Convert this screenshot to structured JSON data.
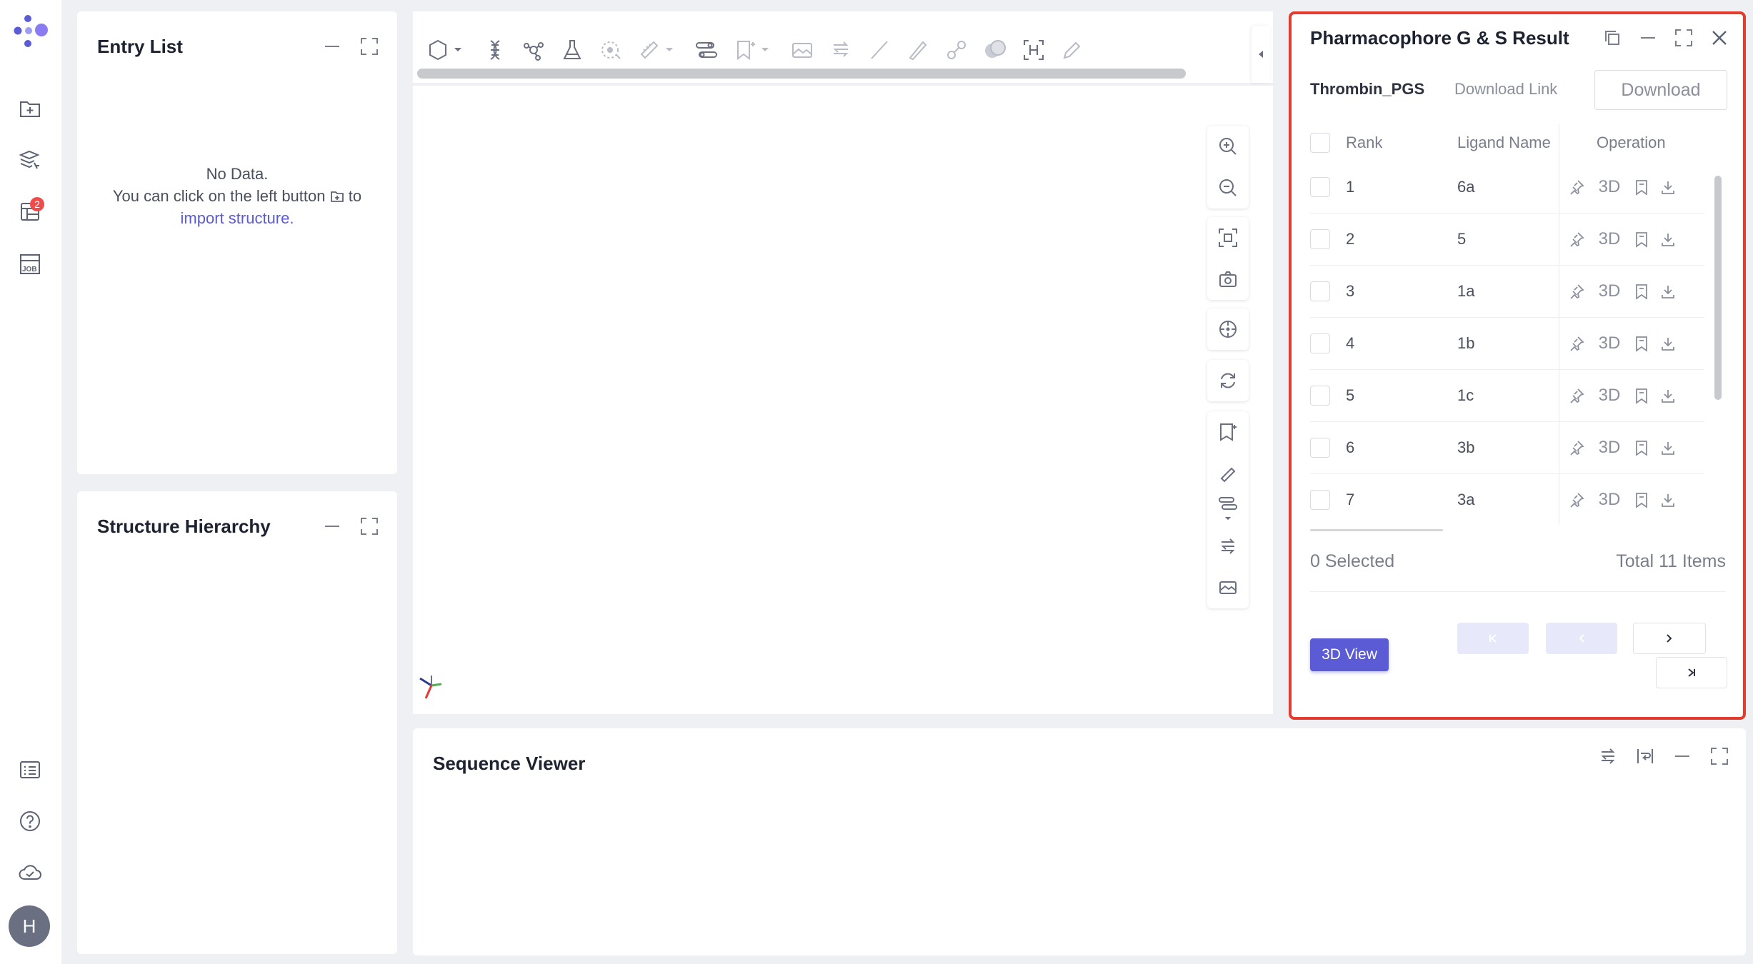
{
  "app": {
    "logo": "app-logo",
    "rail_badge": "2",
    "avatar_initial": "H"
  },
  "entry_list": {
    "title": "Entry List",
    "empty_line1": "No Data.",
    "empty_line2_pre": "You can click on the left button",
    "empty_line2_post": "to",
    "empty_link": "import structure."
  },
  "structure_hierarchy": {
    "title": "Structure Hierarchy"
  },
  "result_panel": {
    "title": "Pharmacophore G & S Result",
    "job_name": "Thrombin_PGS",
    "download_link_label": "Download Link",
    "download_button": "Download",
    "columns": {
      "rank": "Rank",
      "ligand": "Ligand Name",
      "operation": "Operation"
    },
    "op_3d_label": "3D",
    "rows": [
      {
        "rank": "1",
        "ligand": "6a"
      },
      {
        "rank": "2",
        "ligand": "5"
      },
      {
        "rank": "3",
        "ligand": "1a"
      },
      {
        "rank": "4",
        "ligand": "1b"
      },
      {
        "rank": "5",
        "ligand": "1c"
      },
      {
        "rank": "6",
        "ligand": "3b"
      },
      {
        "rank": "7",
        "ligand": "3a"
      }
    ],
    "selected_text": "0 Selected",
    "total_text": "Total 11 Items",
    "view3d_button": "3D View"
  },
  "sequence_viewer": {
    "title": "Sequence Viewer"
  },
  "colors": {
    "accent": "#5b5bd6",
    "highlight_border": "#e33b2d",
    "badge": "#ef4b4b"
  }
}
